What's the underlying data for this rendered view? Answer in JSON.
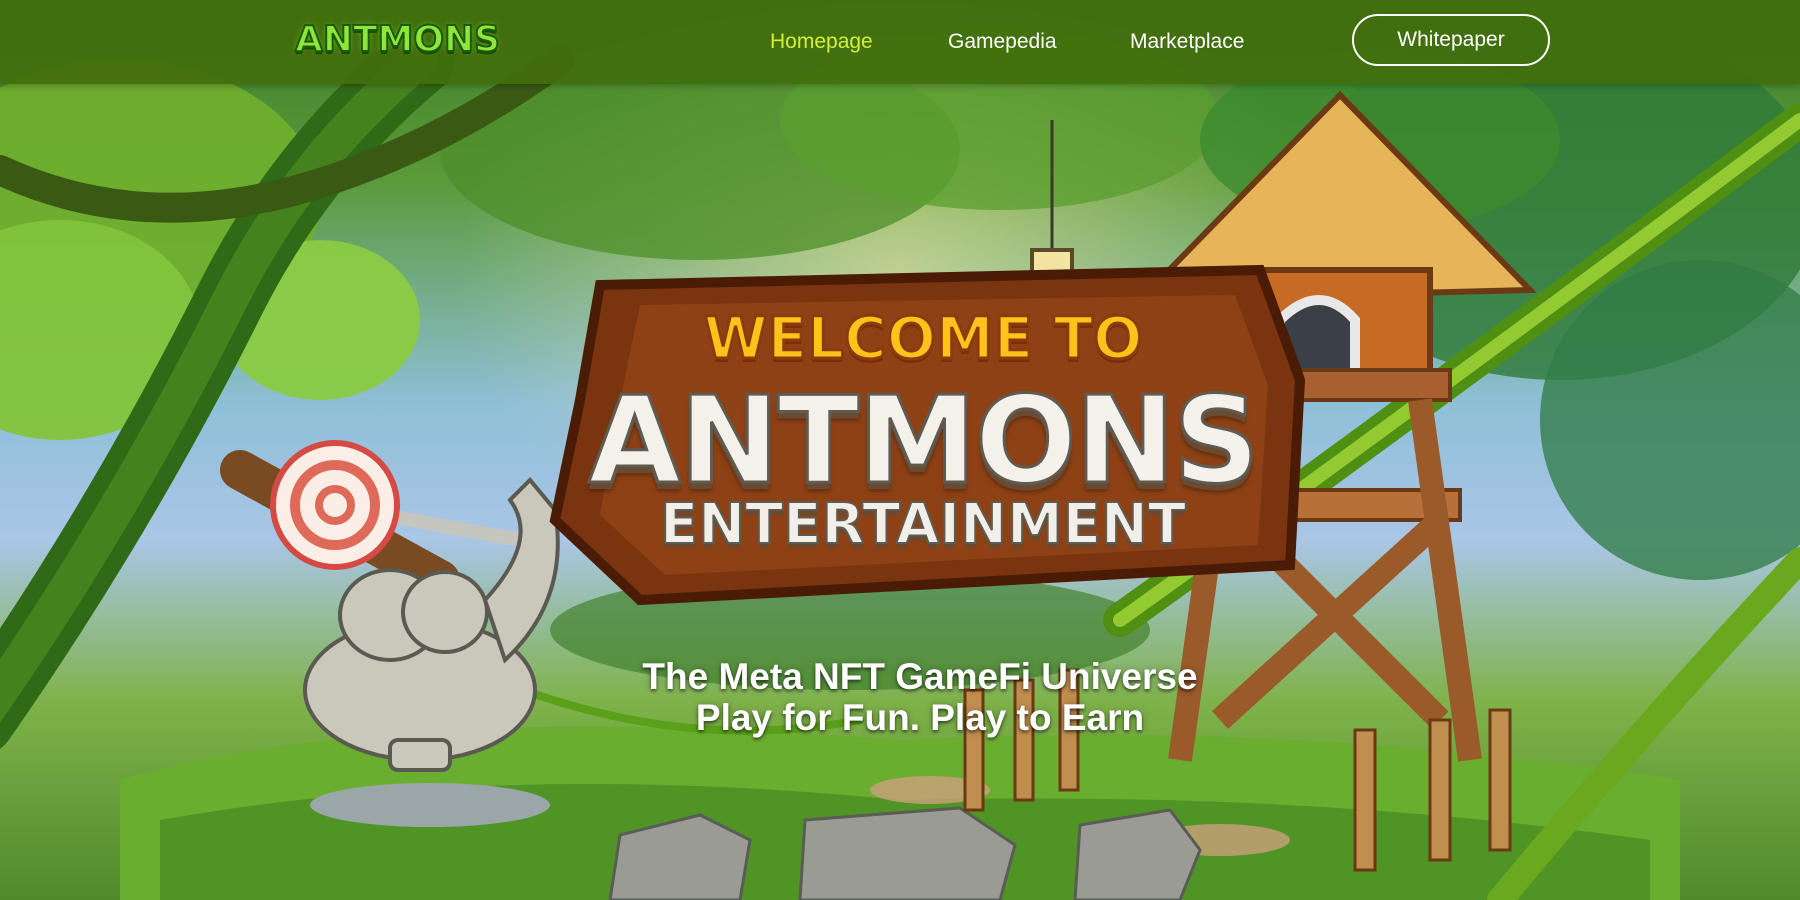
{
  "brand": {
    "logo_text": "ANTMONS"
  },
  "nav": {
    "items": [
      {
        "label": "Homepage",
        "active": true
      },
      {
        "label": "Gamepedia",
        "active": false
      },
      {
        "label": "Marketplace",
        "active": false
      }
    ],
    "whitepaper_label": "Whitepaper"
  },
  "hero": {
    "welcome_line": "WELCOME TO",
    "title_line": "ANTMONS",
    "subtitle_line": "ENTERTAINMENT",
    "tagline_line1": "The Meta NFT GameFi Universe",
    "tagline_line2": "Play for Fun. Play to Earn"
  },
  "colors": {
    "navbar_bg": "#426e0c",
    "nav_active": "#d4ef3a",
    "nav_text": "#ffffff",
    "logo_green": "#8ee63a",
    "sign_gold": "#ffc21a",
    "sign_wood": "#7a3410"
  },
  "icons": [
    "lollipop-icon",
    "treehouse-icon",
    "lantern-icon",
    "stone-creature-icon"
  ]
}
